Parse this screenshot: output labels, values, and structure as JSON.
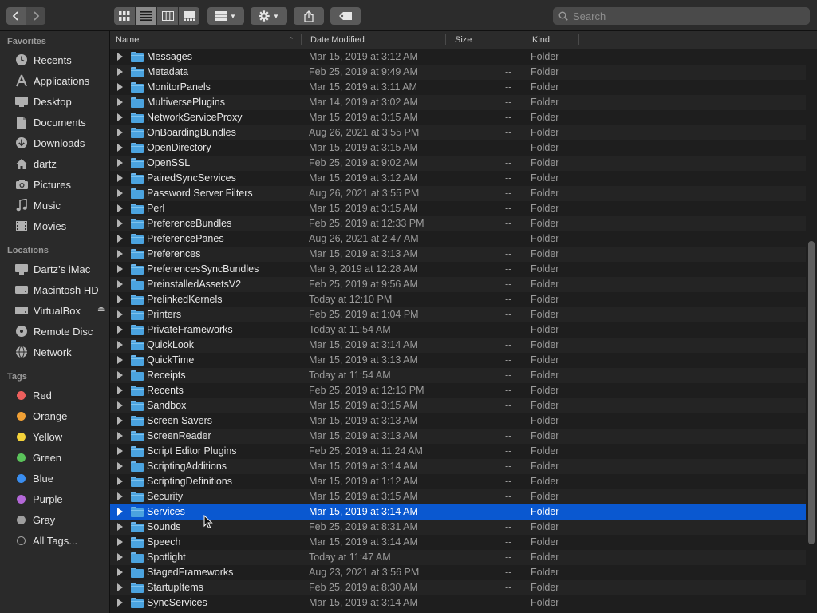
{
  "toolbar": {
    "search_placeholder": "Search",
    "view_active": "list"
  },
  "sidebar": {
    "favorites_heading": "Favorites",
    "favorites": [
      {
        "label": "Recents",
        "icon": "clock-icon"
      },
      {
        "label": "Applications",
        "icon": "applications-icon"
      },
      {
        "label": "Desktop",
        "icon": "desktop-icon"
      },
      {
        "label": "Documents",
        "icon": "document-icon"
      },
      {
        "label": "Downloads",
        "icon": "download-icon"
      },
      {
        "label": "dartz",
        "icon": "home-icon"
      },
      {
        "label": "Pictures",
        "icon": "camera-icon"
      },
      {
        "label": "Music",
        "icon": "music-icon"
      },
      {
        "label": "Movies",
        "icon": "film-icon"
      }
    ],
    "locations_heading": "Locations",
    "locations": [
      {
        "label": "Dartz’s iMac",
        "icon": "computer-icon"
      },
      {
        "label": "Macintosh HD",
        "icon": "hard-drive-icon"
      },
      {
        "label": "VirtualBox",
        "icon": "hard-drive-icon"
      },
      {
        "label": "Remote Disc",
        "icon": "disc-icon"
      },
      {
        "label": "Network",
        "icon": "network-icon"
      }
    ],
    "tags_heading": "Tags",
    "tags": [
      {
        "label": "Red",
        "color": "#ec5f5d"
      },
      {
        "label": "Orange",
        "color": "#f0a035"
      },
      {
        "label": "Yellow",
        "color": "#f5d33a"
      },
      {
        "label": "Green",
        "color": "#5ac35a"
      },
      {
        "label": "Blue",
        "color": "#3a8ef0"
      },
      {
        "label": "Purple",
        "color": "#b468d8"
      },
      {
        "label": "Gray",
        "color": "#9e9e9e"
      },
      {
        "label": "All Tags...",
        "color": ""
      }
    ]
  },
  "columns": {
    "name": "Name",
    "date": "Date Modified",
    "size": "Size",
    "kind": "Kind"
  },
  "files": [
    {
      "name": "Messages",
      "date": "Mar 15, 2019 at 3:12 AM",
      "size": "--",
      "kind": "Folder"
    },
    {
      "name": "Metadata",
      "date": "Feb 25, 2019 at 9:49 AM",
      "size": "--",
      "kind": "Folder"
    },
    {
      "name": "MonitorPanels",
      "date": "Mar 15, 2019 at 3:11 AM",
      "size": "--",
      "kind": "Folder"
    },
    {
      "name": "MultiversePlugins",
      "date": "Mar 14, 2019 at 3:02 AM",
      "size": "--",
      "kind": "Folder"
    },
    {
      "name": "NetworkServiceProxy",
      "date": "Mar 15, 2019 at 3:15 AM",
      "size": "--",
      "kind": "Folder"
    },
    {
      "name": "OnBoardingBundles",
      "date": "Aug 26, 2021 at 3:55 PM",
      "size": "--",
      "kind": "Folder"
    },
    {
      "name": "OpenDirectory",
      "date": "Mar 15, 2019 at 3:15 AM",
      "size": "--",
      "kind": "Folder"
    },
    {
      "name": "OpenSSL",
      "date": "Feb 25, 2019 at 9:02 AM",
      "size": "--",
      "kind": "Folder"
    },
    {
      "name": "PairedSyncServices",
      "date": "Mar 15, 2019 at 3:12 AM",
      "size": "--",
      "kind": "Folder"
    },
    {
      "name": "Password Server Filters",
      "date": "Aug 26, 2021 at 3:55 PM",
      "size": "--",
      "kind": "Folder"
    },
    {
      "name": "Perl",
      "date": "Mar 15, 2019 at 3:15 AM",
      "size": "--",
      "kind": "Folder"
    },
    {
      "name": "PreferenceBundles",
      "date": "Feb 25, 2019 at 12:33 PM",
      "size": "--",
      "kind": "Folder"
    },
    {
      "name": "PreferencePanes",
      "date": "Aug 26, 2021 at 2:47 AM",
      "size": "--",
      "kind": "Folder"
    },
    {
      "name": "Preferences",
      "date": "Mar 15, 2019 at 3:13 AM",
      "size": "--",
      "kind": "Folder"
    },
    {
      "name": "PreferencesSyncBundles",
      "date": "Mar 9, 2019 at 12:28 AM",
      "size": "--",
      "kind": "Folder"
    },
    {
      "name": "PreinstalledAssetsV2",
      "date": "Feb 25, 2019 at 9:56 AM",
      "size": "--",
      "kind": "Folder"
    },
    {
      "name": "PrelinkedKernels",
      "date": "Today at 12:10 PM",
      "size": "--",
      "kind": "Folder"
    },
    {
      "name": "Printers",
      "date": "Feb 25, 2019 at 1:04 PM",
      "size": "--",
      "kind": "Folder"
    },
    {
      "name": "PrivateFrameworks",
      "date": "Today at 11:54 AM",
      "size": "--",
      "kind": "Folder"
    },
    {
      "name": "QuickLook",
      "date": "Mar 15, 2019 at 3:14 AM",
      "size": "--",
      "kind": "Folder"
    },
    {
      "name": "QuickTime",
      "date": "Mar 15, 2019 at 3:13 AM",
      "size": "--",
      "kind": "Folder"
    },
    {
      "name": "Receipts",
      "date": "Today at 11:54 AM",
      "size": "--",
      "kind": "Folder"
    },
    {
      "name": "Recents",
      "date": "Feb 25, 2019 at 12:13 PM",
      "size": "--",
      "kind": "Folder"
    },
    {
      "name": "Sandbox",
      "date": "Mar 15, 2019 at 3:15 AM",
      "size": "--",
      "kind": "Folder"
    },
    {
      "name": "Screen Savers",
      "date": "Mar 15, 2019 at 3:13 AM",
      "size": "--",
      "kind": "Folder"
    },
    {
      "name": "ScreenReader",
      "date": "Mar 15, 2019 at 3:13 AM",
      "size": "--",
      "kind": "Folder"
    },
    {
      "name": "Script Editor Plugins",
      "date": "Feb 25, 2019 at 11:24 AM",
      "size": "--",
      "kind": "Folder"
    },
    {
      "name": "ScriptingAdditions",
      "date": "Mar 15, 2019 at 3:14 AM",
      "size": "--",
      "kind": "Folder"
    },
    {
      "name": "ScriptingDefinitions",
      "date": "Mar 15, 2019 at 1:12 AM",
      "size": "--",
      "kind": "Folder"
    },
    {
      "name": "Security",
      "date": "Mar 15, 2019 at 3:15 AM",
      "size": "--",
      "kind": "Folder"
    },
    {
      "name": "Services",
      "date": "Mar 15, 2019 at 3:14 AM",
      "size": "--",
      "kind": "Folder",
      "selected": true
    },
    {
      "name": "Sounds",
      "date": "Feb 25, 2019 at 8:31 AM",
      "size": "--",
      "kind": "Folder"
    },
    {
      "name": "Speech",
      "date": "Mar 15, 2019 at 3:14 AM",
      "size": "--",
      "kind": "Folder"
    },
    {
      "name": "Spotlight",
      "date": "Today at 11:47 AM",
      "size": "--",
      "kind": "Folder"
    },
    {
      "name": "StagedFrameworks",
      "date": "Aug 23, 2021 at 3:56 PM",
      "size": "--",
      "kind": "Folder"
    },
    {
      "name": "StartupItems",
      "date": "Feb 25, 2019 at 8:30 AM",
      "size": "--",
      "kind": "Folder"
    },
    {
      "name": "SyncServices",
      "date": "Mar 15, 2019 at 3:14 AM",
      "size": "--",
      "kind": "Folder"
    }
  ]
}
